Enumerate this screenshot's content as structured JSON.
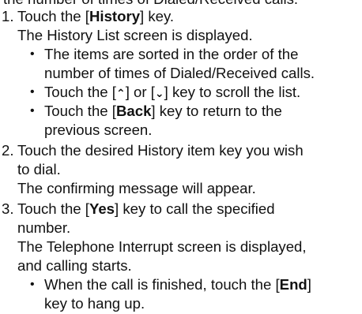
{
  "doc": {
    "top_line": "the number of times of Dialed/Received calls.",
    "step1": {
      "num": "1.",
      "pre": "Touch the [",
      "key": "History",
      "post": "] key.",
      "result": "The History List screen is displayed.",
      "bullets": [
        {
          "line1": "The items are sorted in the order of the",
          "line2": "number of times of Dialed/Received calls."
        },
        {
          "pre": "Touch the [",
          "up_glyph": "⌃",
          "mid": "] or [",
          "down_glyph": "⌄",
          "post": "] key to scroll the list."
        },
        {
          "pre": "Touch the [",
          "key": "Back",
          "post": "] key to return to the",
          "line2": "previous screen."
        }
      ]
    },
    "step2": {
      "num": "2.",
      "line1": "Touch the desired History item key you wish",
      "line2": "to dial.",
      "result": "The confirming message will appear."
    },
    "step3": {
      "num": "3.",
      "pre": "Touch the [",
      "key": "Yes",
      "post": "] key to call the specified",
      "line2": "number.",
      "result1": "The Telephone Interrupt screen is displayed,",
      "result2": "and calling starts.",
      "bullet": {
        "pre": "When the call is finished, touch the [",
        "key": "End",
        "post": "]",
        "line2": "key to hang up."
      }
    }
  }
}
